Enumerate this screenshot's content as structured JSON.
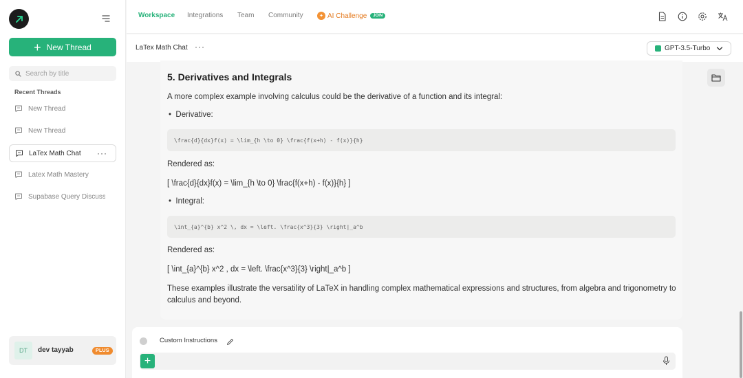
{
  "sidebar": {
    "new_thread_label": "New Thread",
    "search_placeholder": "Search by title",
    "recent_label": "Recent Threads",
    "threads": [
      {
        "label": "New Thread"
      },
      {
        "label": "New Thread"
      },
      {
        "label": "LaTex Math Chat"
      },
      {
        "label": "Latex Math Mastery"
      },
      {
        "label": "Supabase Query Discussi"
      }
    ],
    "user": {
      "initials": "DT",
      "name": "dev tayyab",
      "badge": "PLUS"
    }
  },
  "nav": {
    "items": [
      "Workspace",
      "Integrations",
      "Team",
      "Community"
    ],
    "ai_challenge": "AI Challenge",
    "join_badge": "JOIN"
  },
  "thread": {
    "title": "LaTex Math Chat",
    "more": "···",
    "model": "GPT-3.5-Turbo"
  },
  "content": {
    "heading": "5. Derivatives and Integrals",
    "intro": "A more complex example involving calculus could be the derivative of a function and its integral:",
    "derivative_label": "Derivative:",
    "derivative_code": "\\frac{d}{dx}f(x) = \\lim_{h \\to 0} \\frac{f(x+h) - f(x)}{h}",
    "rendered_as_1": "Rendered as:",
    "derivative_rendered": "[ \\frac{d}{dx}f(x) = \\lim_{h \\to 0} \\frac{f(x+h) - f(x)}{h} ]",
    "integral_label": "Integral:",
    "integral_code": "\\int_{a}^{b} x^2 \\, dx = \\left. \\frac{x^3}{3} \\right|_a^b",
    "rendered_as_2": "Rendered as:",
    "integral_rendered": "[ \\int_{a}^{b} x^2 , dx = \\left. \\frac{x^3}{3} \\right|_a^b ]",
    "conclusion": "These examples illustrate the versatility of LaTeX in handling complex mathematical expressions and structures, from algebra and trigonometry to calculus and beyond."
  },
  "input": {
    "custom_instructions": "Custom Instructions",
    "placeholder": ""
  },
  "colors": {
    "accent": "#27b27a",
    "orange": "#f08b2e"
  },
  "icons": [
    "logo-arrow-icon",
    "menu-icon",
    "plus-icon",
    "search-icon",
    "chat-bubble-icon",
    "document-icon",
    "info-icon",
    "gear-icon",
    "translate-icon",
    "chevron-down-icon",
    "folder-icon",
    "pencil-icon",
    "microphone-icon"
  ]
}
